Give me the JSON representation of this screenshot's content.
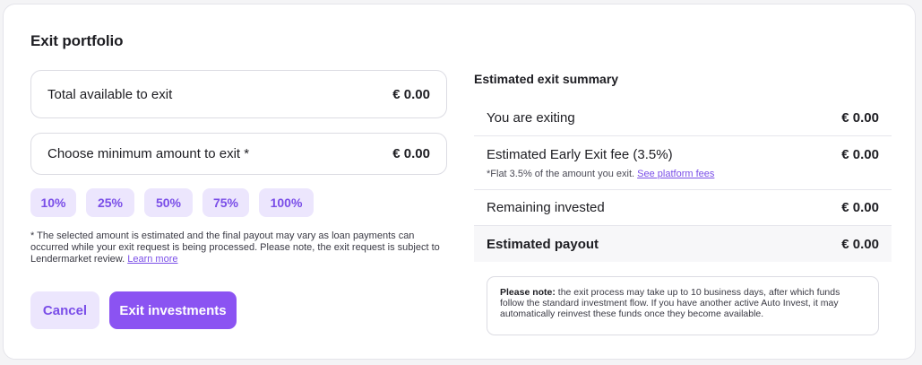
{
  "page": {
    "title": "Exit portfolio"
  },
  "total_box": {
    "label": "Total available to exit",
    "value": "€ 0.00"
  },
  "minimum_box": {
    "label": "Choose minimum amount to exit *",
    "value": "€ 0.00"
  },
  "percent_chips": [
    "10%",
    "25%",
    "50%",
    "75%",
    "100%"
  ],
  "disclaimer": {
    "text": "* The selected amount is estimated and the final payout may vary as loan payments can occurred while your exit request is being processed. Please note, the exit request is subject to Lendermarket review.",
    "link": "Learn more"
  },
  "buttons": {
    "cancel": "Cancel",
    "exit": "Exit investments"
  },
  "summary": {
    "title": "Estimated exit summary",
    "rows": [
      {
        "label": "You are exiting",
        "value": "€ 0.00"
      },
      {
        "label": "Estimated Early Exit fee (3.5%)",
        "value": "€ 0.00",
        "sub": "*Flat 3.5% of the amount you exit.",
        "sub_link": "See platform fees"
      },
      {
        "label": "Remaining invested",
        "value": "€ 0.00"
      },
      {
        "label": "Estimated payout",
        "value": "€ 0.00"
      }
    ]
  },
  "note": {
    "bold": "Please note:",
    "text": "the exit process may take up to 10 business days, after which funds follow the standard investment flow. If you have another active Auto Invest, it may automatically reinvest these funds once they become available."
  },
  "colors": {
    "accent": "#8b53f2",
    "chip_bg": "#ece6fd",
    "chip_text": "#7a4ee8"
  }
}
